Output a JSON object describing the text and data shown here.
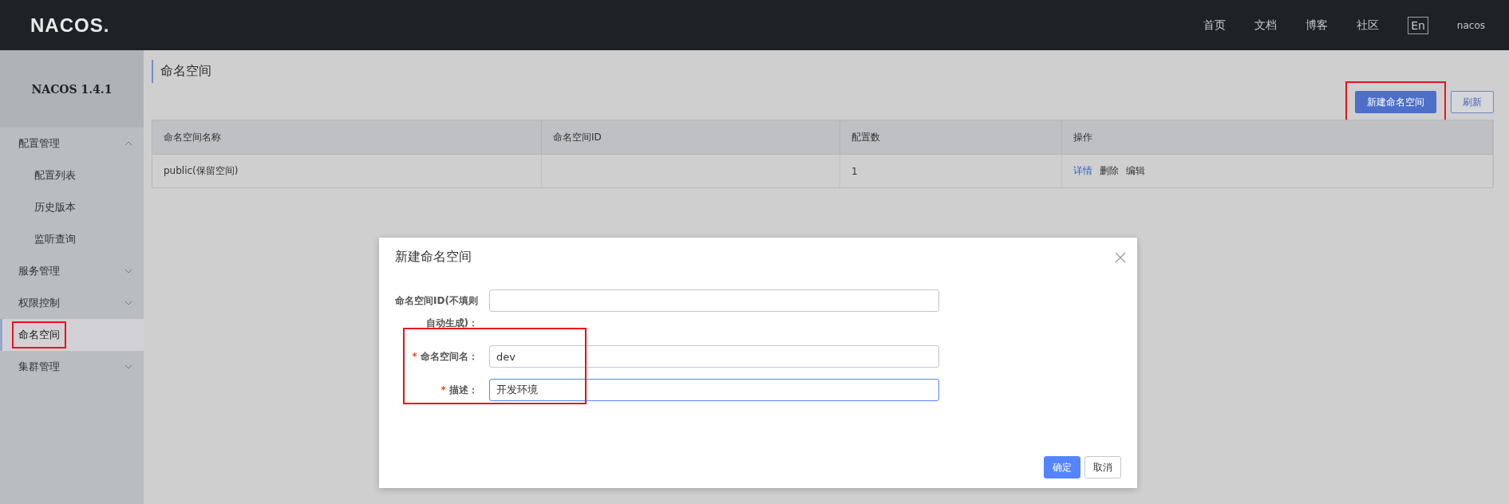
{
  "header": {
    "logo": "NACOS.",
    "nav": [
      {
        "label": "首页"
      },
      {
        "label": "文档"
      },
      {
        "label": "博客"
      },
      {
        "label": "社区"
      }
    ],
    "lang": "En",
    "user": "nacos"
  },
  "sidebar": {
    "title": "NACOS 1.4.1",
    "items": [
      {
        "label": "配置管理",
        "expanded": true,
        "selected": false,
        "highlighted": false,
        "children": [
          {
            "label": "配置列表",
            "selected": false
          },
          {
            "label": "历史版本",
            "selected": false
          },
          {
            "label": "监听查询",
            "selected": false
          }
        ]
      },
      {
        "label": "服务管理",
        "expanded": false,
        "selected": false,
        "highlighted": false
      },
      {
        "label": "权限控制",
        "expanded": false,
        "selected": false,
        "highlighted": false
      },
      {
        "label": "命名空间",
        "selected": true,
        "highlighted": true
      },
      {
        "label": "集群管理",
        "expanded": false,
        "selected": false,
        "highlighted": false
      }
    ]
  },
  "page": {
    "title": "命名空间",
    "buttons": [
      {
        "label": "新建命名空间",
        "kind": "primary",
        "highlighted": true
      },
      {
        "label": "刷新",
        "kind": "secondary",
        "highlighted": false
      }
    ]
  },
  "table": {
    "columns": [
      "命名空间名称",
      "命名空间ID",
      "配置数",
      "操作"
    ],
    "rows": [
      {
        "name": "public(保留空间)",
        "id": "",
        "count": "1",
        "actions": [
          {
            "label": "详情",
            "kind": "link"
          },
          {
            "label": "删除",
            "kind": "text"
          },
          {
            "label": "编辑",
            "kind": "text"
          }
        ]
      }
    ]
  },
  "dialog": {
    "title": "新建命名空间",
    "fields": [
      {
        "label": "命名空间ID(不填则自动生成)：",
        "focused": false
      },
      {
        "required_mark": "*",
        "label": "命名空间名：",
        "value": "dev",
        "focused": false
      },
      {
        "required_mark": "*",
        "label": "描述：",
        "value": "开发环境",
        "focused": true
      }
    ],
    "highlight_required": true,
    "buttons": [
      {
        "label": "确定",
        "kind": "primary"
      },
      {
        "label": "取消",
        "kind": "secondary"
      }
    ]
  }
}
